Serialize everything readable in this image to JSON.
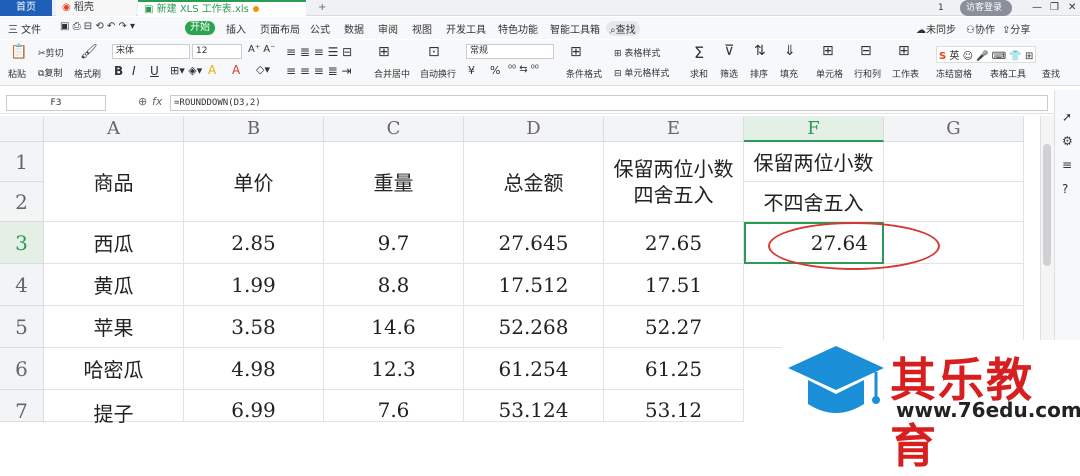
{
  "tabs": {
    "home": "首页",
    "daoke": "稻壳",
    "file": "新建 XLS 工作表.xls",
    "add": "+"
  },
  "window": {
    "badge": "1",
    "login": "访客登录"
  },
  "menu": {
    "file": "三 文件",
    "start": "开始",
    "items": [
      "插入",
      "页面布局",
      "公式",
      "数据",
      "审阅",
      "视图",
      "开发工具",
      "特色功能",
      "智能工具箱"
    ],
    "search": "查找",
    "sync": "未同步",
    "collab": "协作",
    "share": "分享"
  },
  "toolbar": {
    "paste": "粘贴",
    "cut": "剪切",
    "copy": "复制",
    "format_painter": "格式刷",
    "font": "宋体",
    "size": "12",
    "merge": "合并居中",
    "wrap": "自动换行",
    "number_format": "常规",
    "currency": "¥",
    "percent": "%",
    "cond_format": "条件格式",
    "table_style": "表格样式",
    "cell_style": "单元格样式",
    "sum": "求和",
    "filter": "筛选",
    "sort": "排序",
    "fill": "填充",
    "cell": "单元格",
    "rowcol": "行和列",
    "sheet": "工作表",
    "freeze": "冻结窗格",
    "table_tools": "表格工具",
    "find": "查找",
    "ime": "英"
  },
  "formula_bar": {
    "name_box": "F3",
    "fx": "fx",
    "formula": "=ROUNDDOWN(D3,2)"
  },
  "columns": [
    "A",
    "B",
    "C",
    "D",
    "E",
    "F",
    "G"
  ],
  "rows": [
    "1",
    "2",
    "3",
    "4",
    "5",
    "6",
    "7"
  ],
  "header": {
    "a": "商品",
    "b": "单价",
    "c": "重量",
    "d": "总金额",
    "e1": "保留两位小数",
    "e2": "四舍五入",
    "f1": "保留两位小数",
    "f2": "不四舍五入"
  },
  "data": [
    {
      "name": "西瓜",
      "price": "2.85",
      "weight": "9.7",
      "total": "27.645",
      "round": "27.65",
      "down": "27.64"
    },
    {
      "name": "黄瓜",
      "price": "1.99",
      "weight": "8.8",
      "total": "17.512",
      "round": "17.51",
      "down": ""
    },
    {
      "name": "苹果",
      "price": "3.58",
      "weight": "14.6",
      "total": "52.268",
      "round": "52.27",
      "down": ""
    },
    {
      "name": "哈密瓜",
      "price": "4.98",
      "weight": "12.3",
      "total": "61.254",
      "round": "61.25",
      "down": ""
    },
    {
      "name": "提子",
      "price": "6.99",
      "weight": "7.6",
      "total": "53.124",
      "round": "53.12",
      "down": ""
    }
  ],
  "watermark": {
    "title": "其乐教育",
    "url": "www.76edu.com"
  },
  "colors": {
    "accent": "#2a9a54",
    "highlight": "#d43a33",
    "brand_blue": "#1f5fb8"
  }
}
